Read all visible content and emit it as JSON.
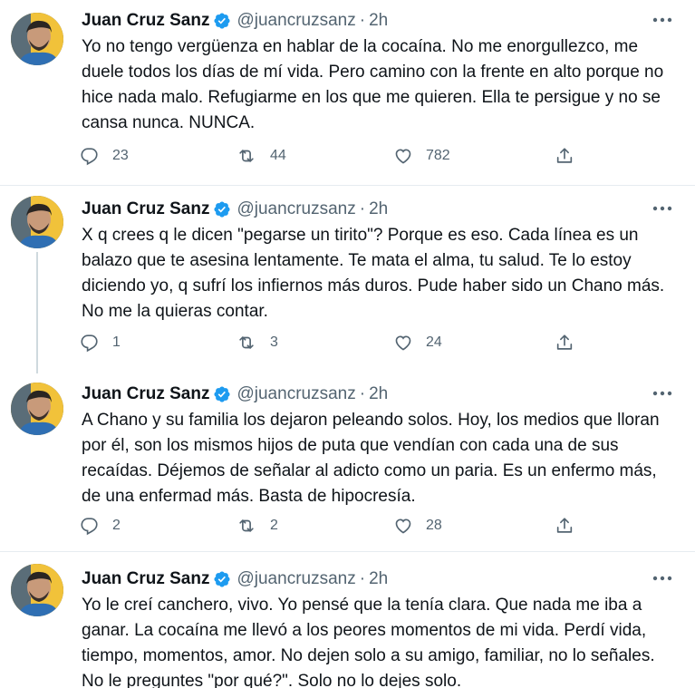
{
  "tweets": [
    {
      "name": "Juan Cruz Sanz",
      "handle": "@juancruzsanz",
      "separator": "·",
      "time": "2h",
      "text": "Yo no tengo vergüenza en hablar de la cocaína. No me  enorgullezco, me duele todos los días de mí vida. Pero camino con la frente en alto porque no hice nada malo. Refugiarme en los que me quieren. Ella te persigue y no se cansa nunca. NUNCA.",
      "replies": "23",
      "retweets": "44",
      "likes": "782"
    },
    {
      "name": "Juan Cruz Sanz",
      "handle": "@juancruzsanz",
      "separator": "·",
      "time": "2h",
      "text": "X q crees q le dicen \"pegarse un tirito\"? Porque es eso. Cada línea es un balazo que te asesina lentamente. Te mata el alma, tu salud. Te lo estoy diciendo yo, q sufrí los infiernos más duros. Pude haber sido un Chano más. No me la quieras contar.",
      "replies": "1",
      "retweets": "3",
      "likes": "24"
    },
    {
      "name": "Juan Cruz Sanz",
      "handle": "@juancruzsanz",
      "separator": "·",
      "time": "2h",
      "text": "A Chano y su familia los dejaron peleando solos. Hoy, los medios que lloran por él, son los mismos hijos de puta que vendían con cada una de sus recaídas. Déjemos de señalar al adicto como un paria. Es un enfermo más, de una enfermad más. Basta de hipocresía.",
      "replies": "2",
      "retweets": "2",
      "likes": "28"
    },
    {
      "name": "Juan Cruz Sanz",
      "handle": "@juancruzsanz",
      "separator": "·",
      "time": "2h",
      "text": "Yo le creí canchero, vivo. Yo pensé que la tenía clara. Que nada me iba a ganar. La cocaína me llevó a los peores momentos de mi vida. Perdí vida, tiempo, momentos, amor. No dejen solo a su amigo, familiar, no lo señales. No le preguntes \"por qué?\". Solo no lo dejes solo."
    }
  ],
  "icons": {
    "verified": "verified-badge-icon",
    "more": "more-options-icon",
    "reply": "reply-icon",
    "retweet": "retweet-icon",
    "like": "heart-icon",
    "share": "share-icon"
  },
  "colors": {
    "text": "#0f1419",
    "secondary": "#536471",
    "verified": "#1d9bf0",
    "divider": "#e6ecf0"
  }
}
